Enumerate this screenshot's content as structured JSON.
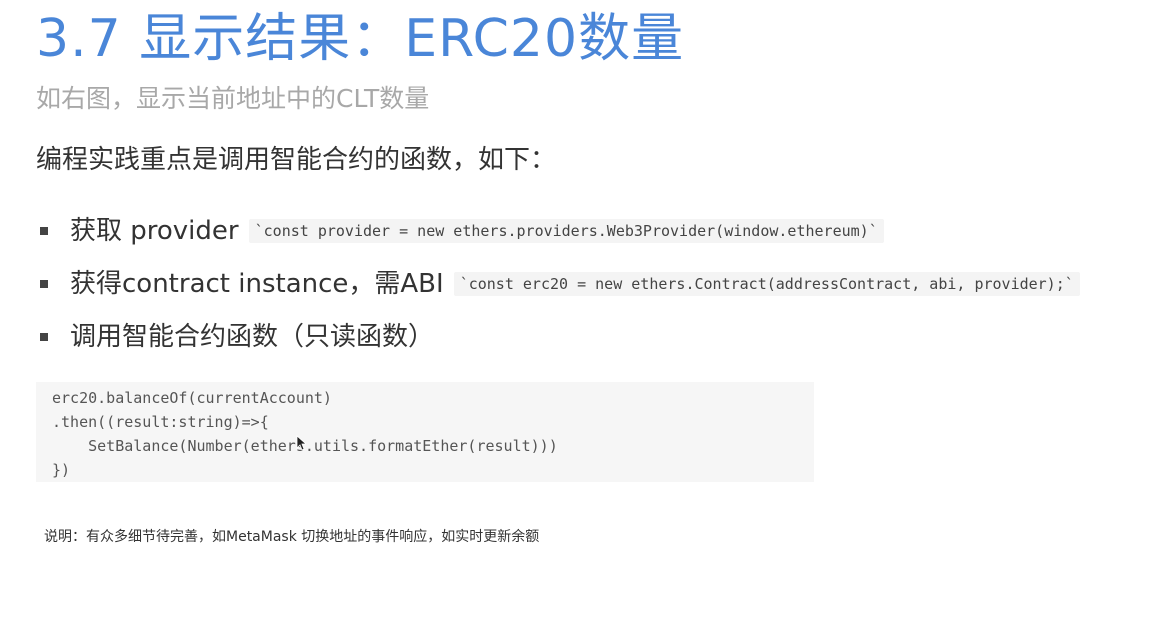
{
  "slide": {
    "title": "3.7 显示结果：ERC20数量",
    "subtitle": "如右图，显示当前地址中的CLT数量",
    "lead": "编程实践重点是调用智能合约的函数，如下：",
    "bullets": [
      {
        "text": "获取 provider",
        "code": "`const provider = new ethers.providers.Web3Provider(window.ethereum)`"
      },
      {
        "text": "获得contract instance，需ABI",
        "code": "`const erc20 = new ethers.Contract(addressContract, abi, provider);`"
      },
      {
        "text": "调用智能合约函数（只读函数）"
      }
    ],
    "code_lines": [
      "erc20.balanceOf(currentAccount)",
      ".then((result:string)=>{",
      "    SetBalance(Number(ethers.utils.formatEther(result)))",
      "})"
    ],
    "note": "说明：有众多细节待完善，如MetaMask 切换地址的事件响应，如实时更新余额"
  },
  "colors": {
    "title": "#4a86d8",
    "subtitle": "#a8a8a8",
    "code_background": "#f6f6f6"
  },
  "icons": {
    "cursor": "mouse-pointer-icon"
  }
}
